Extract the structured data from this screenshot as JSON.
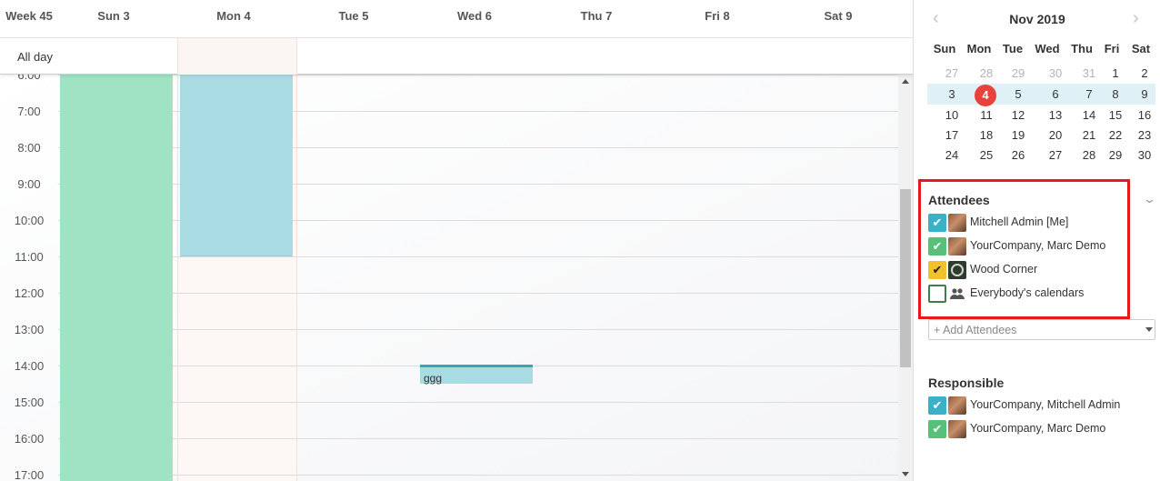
{
  "week_header": {
    "week_label": "Week 45",
    "days": [
      "Sun 3",
      "Mon 4",
      "Tue 5",
      "Wed 6",
      "Thu 7",
      "Fri 8",
      "Sat 9"
    ]
  },
  "allday_label": "All day",
  "time_labels": [
    "6:00",
    "7:00",
    "8:00",
    "9:00",
    "10:00",
    "11:00",
    "12:00",
    "13:00",
    "14:00",
    "15:00",
    "16:00",
    "17:00"
  ],
  "events": {
    "wed_title": "ggg"
  },
  "colors": {
    "event_green": "#9fe3c4",
    "event_blue": "#a8dbe2",
    "today_red": "#e9423a",
    "check_blue": "#3ab1c8",
    "check_green": "#59c07a",
    "check_yellow": "#f2c12e",
    "highlight_red": "#e8191c"
  },
  "mini_calendar": {
    "title": "Nov 2019",
    "prev_icon": "chevron-left-icon",
    "next_icon": "chevron-right-icon",
    "weekdays": [
      "Sun",
      "Mon",
      "Tue",
      "Wed",
      "Thu",
      "Fri",
      "Sat"
    ],
    "weeks": [
      [
        "27",
        "28",
        "29",
        "30",
        "31",
        "1",
        "2"
      ],
      [
        "3",
        "4",
        "5",
        "6",
        "7",
        "8",
        "9"
      ],
      [
        "10",
        "11",
        "12",
        "13",
        "14",
        "15",
        "16"
      ],
      [
        "17",
        "18",
        "19",
        "20",
        "21",
        "22",
        "23"
      ],
      [
        "24",
        "25",
        "26",
        "27",
        "28",
        "29",
        "30"
      ]
    ],
    "today": "4"
  },
  "attendees": {
    "title": "Attendees",
    "items": [
      {
        "label": "Mitchell Admin [Me]",
        "checked": true
      },
      {
        "label": "YourCompany, Marc Demo",
        "checked": true
      },
      {
        "label": "Wood Corner",
        "checked": true
      },
      {
        "label": "Everybody's calendars",
        "checked": false
      }
    ],
    "add_placeholder": "+ Add Attendees"
  },
  "responsible": {
    "title": "Responsible",
    "items": [
      {
        "label": "YourCompany, Mitchell Admin",
        "checked": true
      },
      {
        "label": "YourCompany, Marc Demo",
        "checked": true
      }
    ]
  }
}
